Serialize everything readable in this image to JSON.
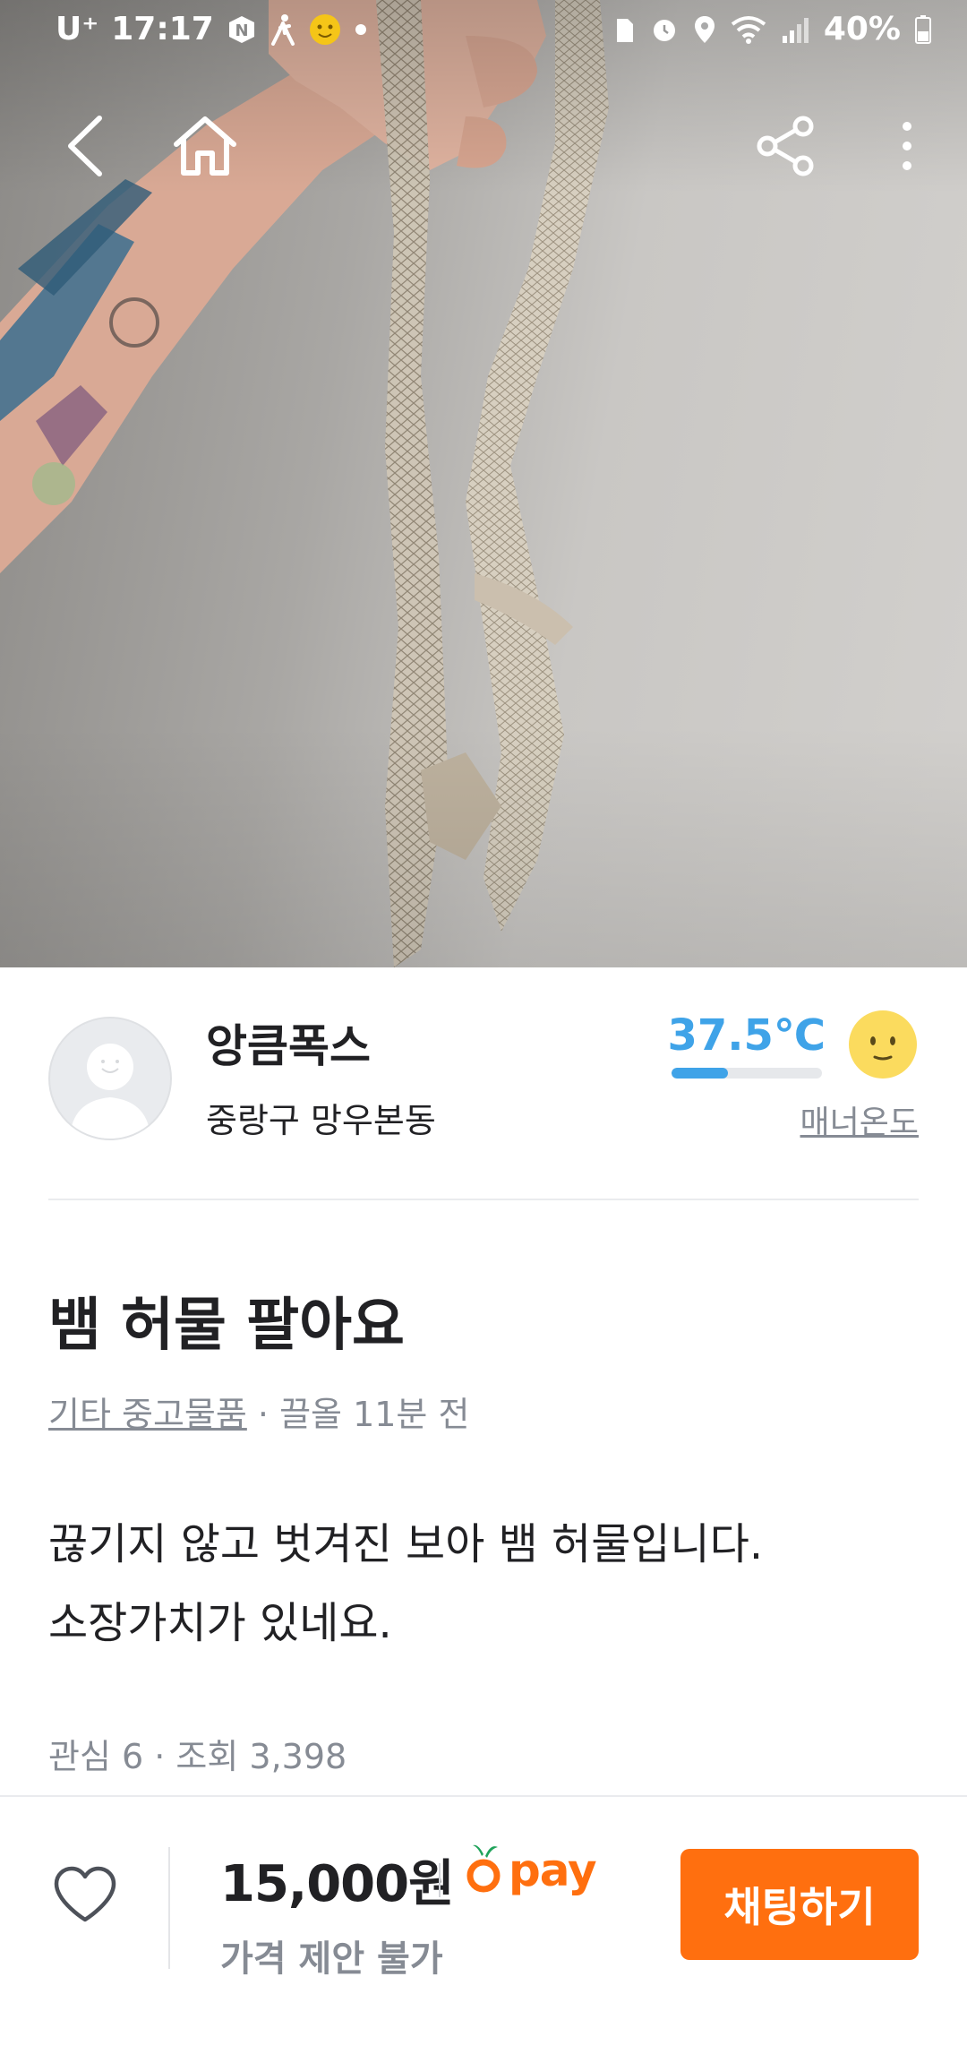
{
  "status_bar": {
    "carrier": "U⁺",
    "time": "17:17",
    "battery": "40%",
    "icons_left": [
      "n-icon",
      "walk-icon",
      "emoji-icon",
      "dot-icon"
    ],
    "icons_right": [
      "sim-icon",
      "alarm-icon",
      "location-icon",
      "wifi-icon",
      "signal-icon",
      "battery-icon"
    ]
  },
  "nav": {
    "icons": [
      "back-icon",
      "home-icon",
      "share-icon",
      "more-icon"
    ]
  },
  "seller": {
    "name": "앙큼폭스",
    "location": "중랑구 망우본동",
    "temperature": "37.5℃",
    "temperature_level": 0.375,
    "manner_label": "매너온도"
  },
  "post": {
    "title": "뱀 허물 팔아요",
    "category": "기타 중고물품",
    "meta_suffix": " · 끌올 11분 전",
    "body_line1": "끊기지 않고 벗겨진 보아 뱀 허물입니다.",
    "body_line2": "소장가치가 있네요.",
    "stats": "관심 6 · 조회 3,398"
  },
  "bottom": {
    "price": "15,000원",
    "pay_label": "pay",
    "price_note": "가격 제안 불가",
    "chat_button": "채팅하기"
  },
  "colors": {
    "accent": "#ff6f0f",
    "temperature": "#3fa3e8",
    "muted_text": "#868b94"
  }
}
